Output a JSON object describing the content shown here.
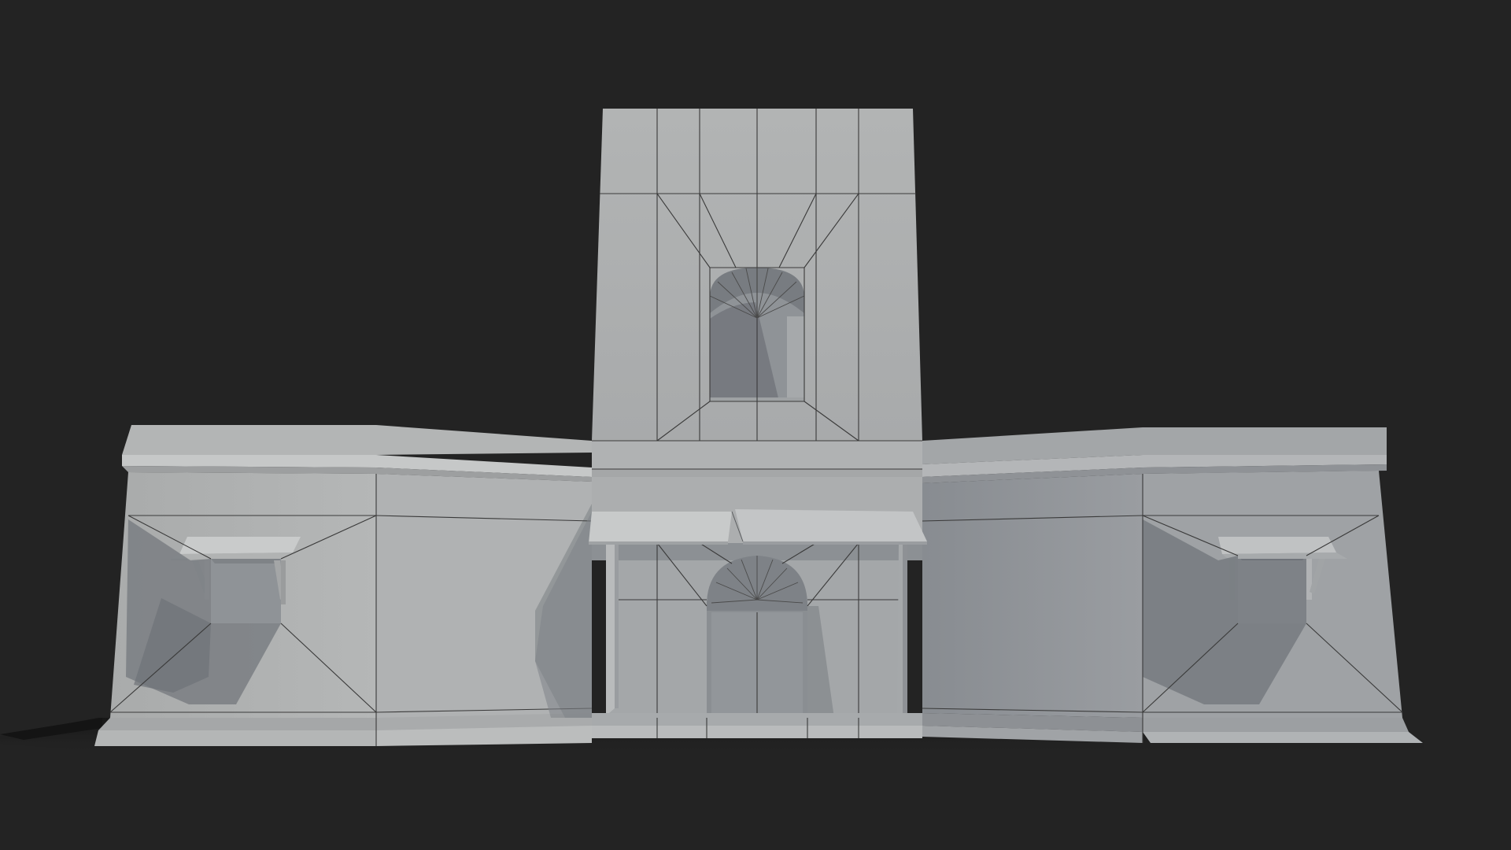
{
  "scene": {
    "subject": "",
    "colors": {
      "background": "#232323",
      "ground_shadow": "#1c1c1c",
      "wall_lit": "#b8b8b8",
      "wall_mid": "#a9a9a9",
      "wall_shade": "#8f9296",
      "wall_dark": "#7b7e82",
      "cast_shadow": "#6e7277",
      "opening_dark": "#6a6d72",
      "trim_light": "#c9cbcb",
      "wireframe": "#3a3a3a"
    },
    "elements": {
      "tower": "tower",
      "left_wing": "left-wing",
      "right_wing": "right-wing",
      "entrance": "entrance",
      "awning_left": "awning",
      "awning_right": "awning",
      "window_left": "window",
      "window_right": "window"
    }
  }
}
